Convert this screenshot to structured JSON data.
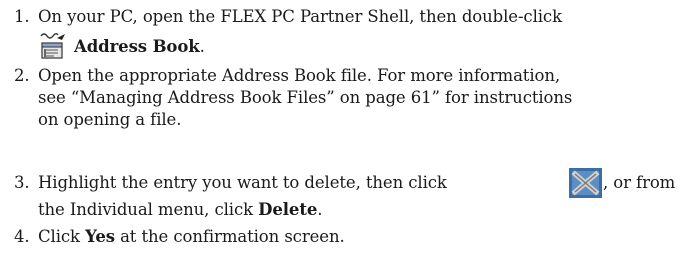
{
  "steps": [
    {
      "number": "1.",
      "lines": [
        "On your PC, open the FLEX PC Partner Shell, then double-click"
      ],
      "bold_label": "Address Book",
      "after_bold": ".",
      "icon": "address-book-icon"
    },
    {
      "number": "2.",
      "lines": [
        "Open the appropriate Address Book file. For more information,",
        "see “Managing Address Book Files” on page 61” for instructions",
        "on opening a file."
      ]
    },
    {
      "number": "3.",
      "before_icon": "Highlight the entry you want to delete, then click",
      "after_icon": ", or from",
      "line2_before_bold": "the Individual menu, click ",
      "bold_label": "Delete",
      "line2_after_bold": ".",
      "icon": "delete-icon"
    },
    {
      "number": "4.",
      "before_bold": "Click ",
      "bold_label": "Yes",
      "after_bold": " at the confirmation screen."
    }
  ],
  "colors": {
    "text": "#1a1a1a",
    "delete_icon_bg": "#3a6ea5",
    "delete_icon_x": "#c0c0c0"
  }
}
